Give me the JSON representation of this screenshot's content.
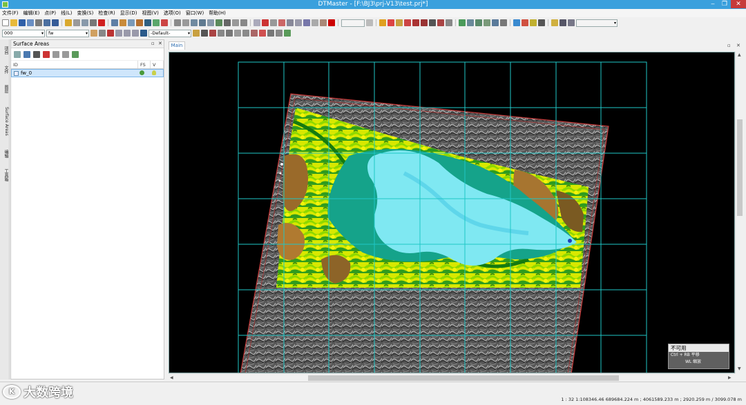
{
  "window": {
    "title": "DTMaster - [F:\\BJ3\\prj-V13\\test.prj*]",
    "min": "‒",
    "max": "❐",
    "close": "✕"
  },
  "menu": [
    "文件(F)",
    "编辑(E)",
    "点(P)",
    "线(L)",
    "变换(S)",
    "检查(R)",
    "显示(D)",
    "视图(V)",
    "选项(O)",
    "窗口(W)",
    "帮助(H)"
  ],
  "toolbar2": {
    "combo1": "000",
    "combo2": "fw",
    "combo3": "-Default-"
  },
  "left_tabs": [
    "项目",
    "文件",
    "图层",
    "Surface Areas",
    "编辑",
    "工具箱"
  ],
  "panel": {
    "title": "Surface Areas",
    "pin": "▫",
    "close": "✕",
    "columns": [
      "ID",
      "FS",
      "V"
    ],
    "rows": [
      {
        "id": "fw_0"
      }
    ]
  },
  "view": {
    "tab": "Main"
  },
  "status_box": {
    "title": "不可用",
    "line1": "Ctrl + RB 平移",
    "line2": "WL 缩放"
  },
  "statusbar": {
    "coords": "1 : 32  1:108346.46  689684.224 m ; 4061589.233 m ; 2920.259 m / 3099.078 m"
  },
  "watermark": {
    "logo": "K",
    "text": "大数跨境"
  },
  "colors": {
    "titlebar": "#3aa0dd",
    "grid": "#1fc7c7",
    "bound": "#d23b3b"
  }
}
